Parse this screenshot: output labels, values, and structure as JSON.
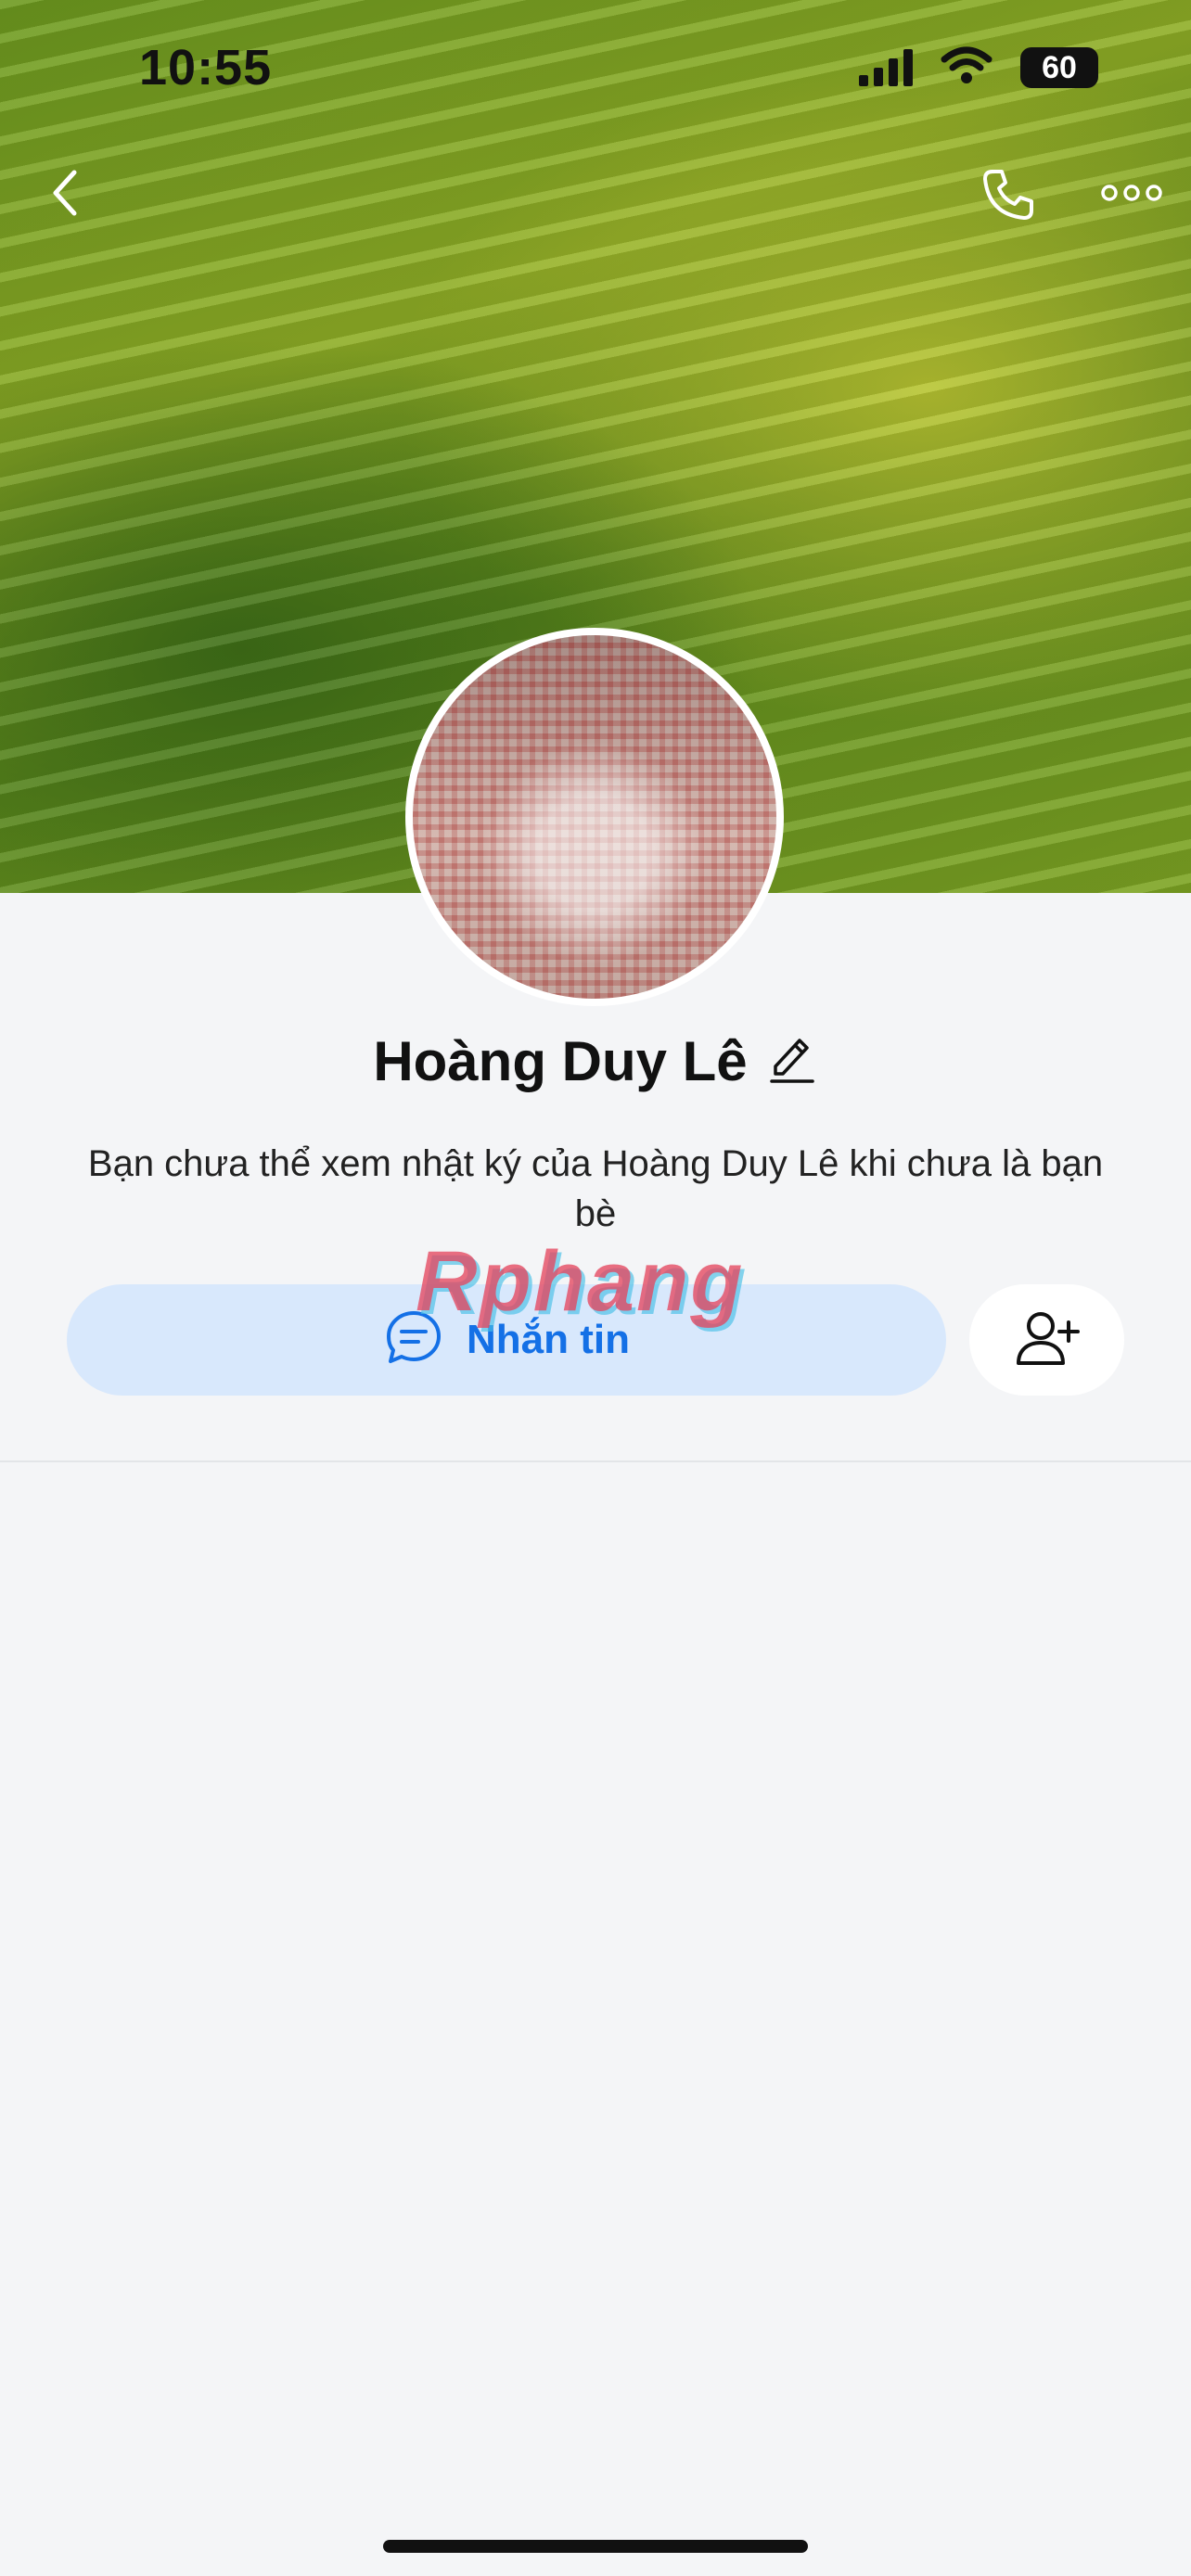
{
  "status_bar": {
    "time": "10:55",
    "battery": "60"
  },
  "profile": {
    "name": "Hoàng Duy Lê",
    "notice": "Bạn chưa thể xem nhật ký của Hoàng Duy Lê khi chưa là bạn bè"
  },
  "actions": {
    "message_label": "Nhắn tin"
  },
  "watermark": "Rphang",
  "icons": {
    "back": "chevron-left-icon",
    "call": "phone-icon",
    "more": "more-dots-icon",
    "edit": "pencil-icon",
    "message": "chat-bubble-icon",
    "add_friend": "add-user-icon"
  },
  "colors": {
    "accent": "#1470e6",
    "button_bg": "#d8e8fc",
    "page_bg": "#f4f5f7"
  }
}
